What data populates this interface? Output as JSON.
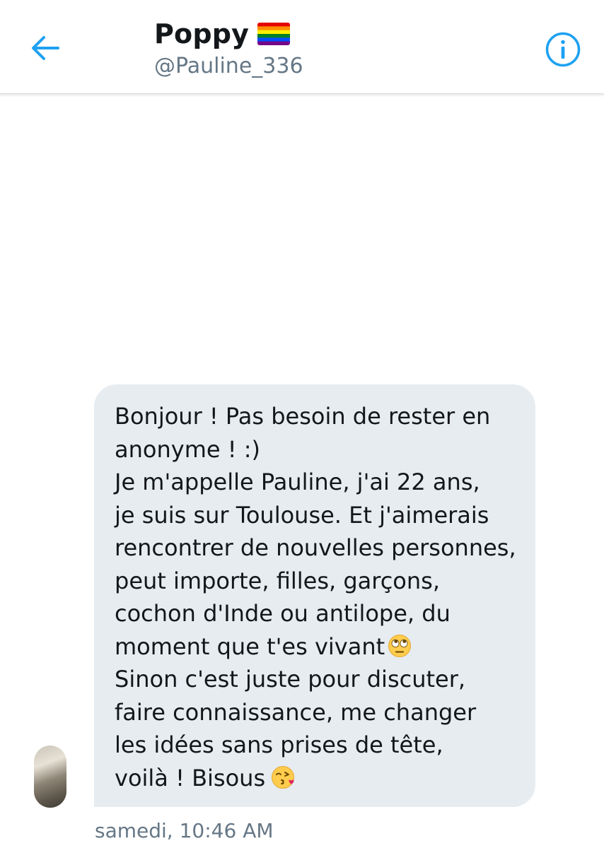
{
  "header": {
    "name": "Poppy",
    "flag_icon": "rainbow-flag-icon",
    "handle": "@Pauline_336",
    "back_icon": "arrow-left-icon",
    "info_icon": "info-icon"
  },
  "message": {
    "lines": [
      "Bonjour ! Pas besoin de rester en",
      "anonyme ! :)",
      "Je m'appelle Pauline, j'ai 22 ans,",
      "je suis sur Toulouse. Et j'aimerais",
      "rencontrer de nouvelles personnes,",
      "peut importe, filles, garçons,",
      "cochon d'Inde ou antilope, du",
      "moment que t'es vivant",
      "Sinon c'est juste pour discuter,",
      "faire connaissance, me changer",
      "les idées sans prises de tête,",
      "voilà ! Bisous"
    ],
    "emoji_1": "eye-roll-emoji",
    "emoji_2": "kiss-emoji",
    "timestamp": "samedi, 10:46 AM"
  },
  "colors": {
    "accent": "#1da1f2",
    "bubble": "#e6ecf0",
    "text": "#14171a",
    "secondary": "#657786"
  }
}
